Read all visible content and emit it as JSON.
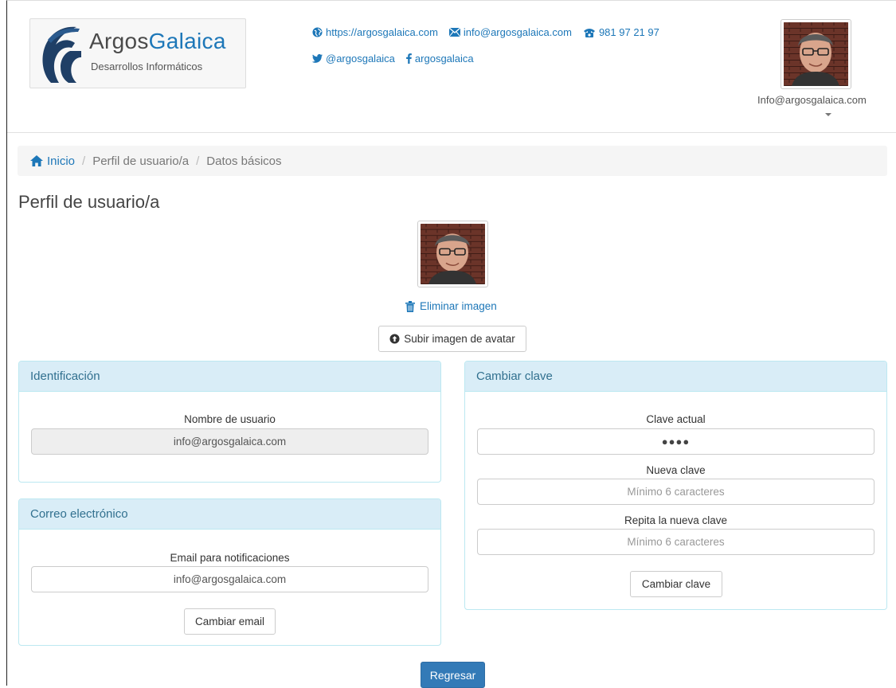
{
  "header": {
    "brand_part1": "Argos",
    "brand_part2": "Galaica",
    "brand_tagline": "Desarrollos Informáticos",
    "contacts": {
      "website": "https://argosgalaica.com",
      "email": "info@argosgalaica.com",
      "phone": "981 97 21 97",
      "twitter": "@argosgalaica",
      "facebook": "argosgalaica"
    },
    "user_email": "Info@argosgalaica.com"
  },
  "breadcrumb": {
    "home": "Inicio",
    "items": [
      "Perfil de usuario/a",
      "Datos básicos"
    ],
    "separator": "/"
  },
  "page": {
    "title": "Perfil de usuario/a",
    "delete_image": "Eliminar imagen",
    "upload_avatar": "Subir imagen de avatar",
    "back_button": "Regresar"
  },
  "identification": {
    "title": "Identificación",
    "username_label": "Nombre de usuario",
    "username_value": "info@argosgalaica.com"
  },
  "email_panel": {
    "title": "Correo electrónico",
    "email_label": "Email para notificaciones",
    "email_value": "info@argosgalaica.com",
    "change_button": "Cambiar email"
  },
  "password_panel": {
    "title": "Cambiar clave",
    "current_label": "Clave actual",
    "current_value": "●●●●",
    "new_label": "Nueva clave",
    "new_placeholder": "Mínimo 6 caracteres",
    "repeat_label": "Repita la nueva clave",
    "repeat_placeholder": "Mínimo 6 caracteres",
    "change_button": "Cambiar clave"
  },
  "colors": {
    "link": "#1d77b8",
    "panel_header_bg": "#d9edf7",
    "panel_border": "#bce8f1",
    "panel_title": "#31708f",
    "primary_button": "#337ab7"
  }
}
